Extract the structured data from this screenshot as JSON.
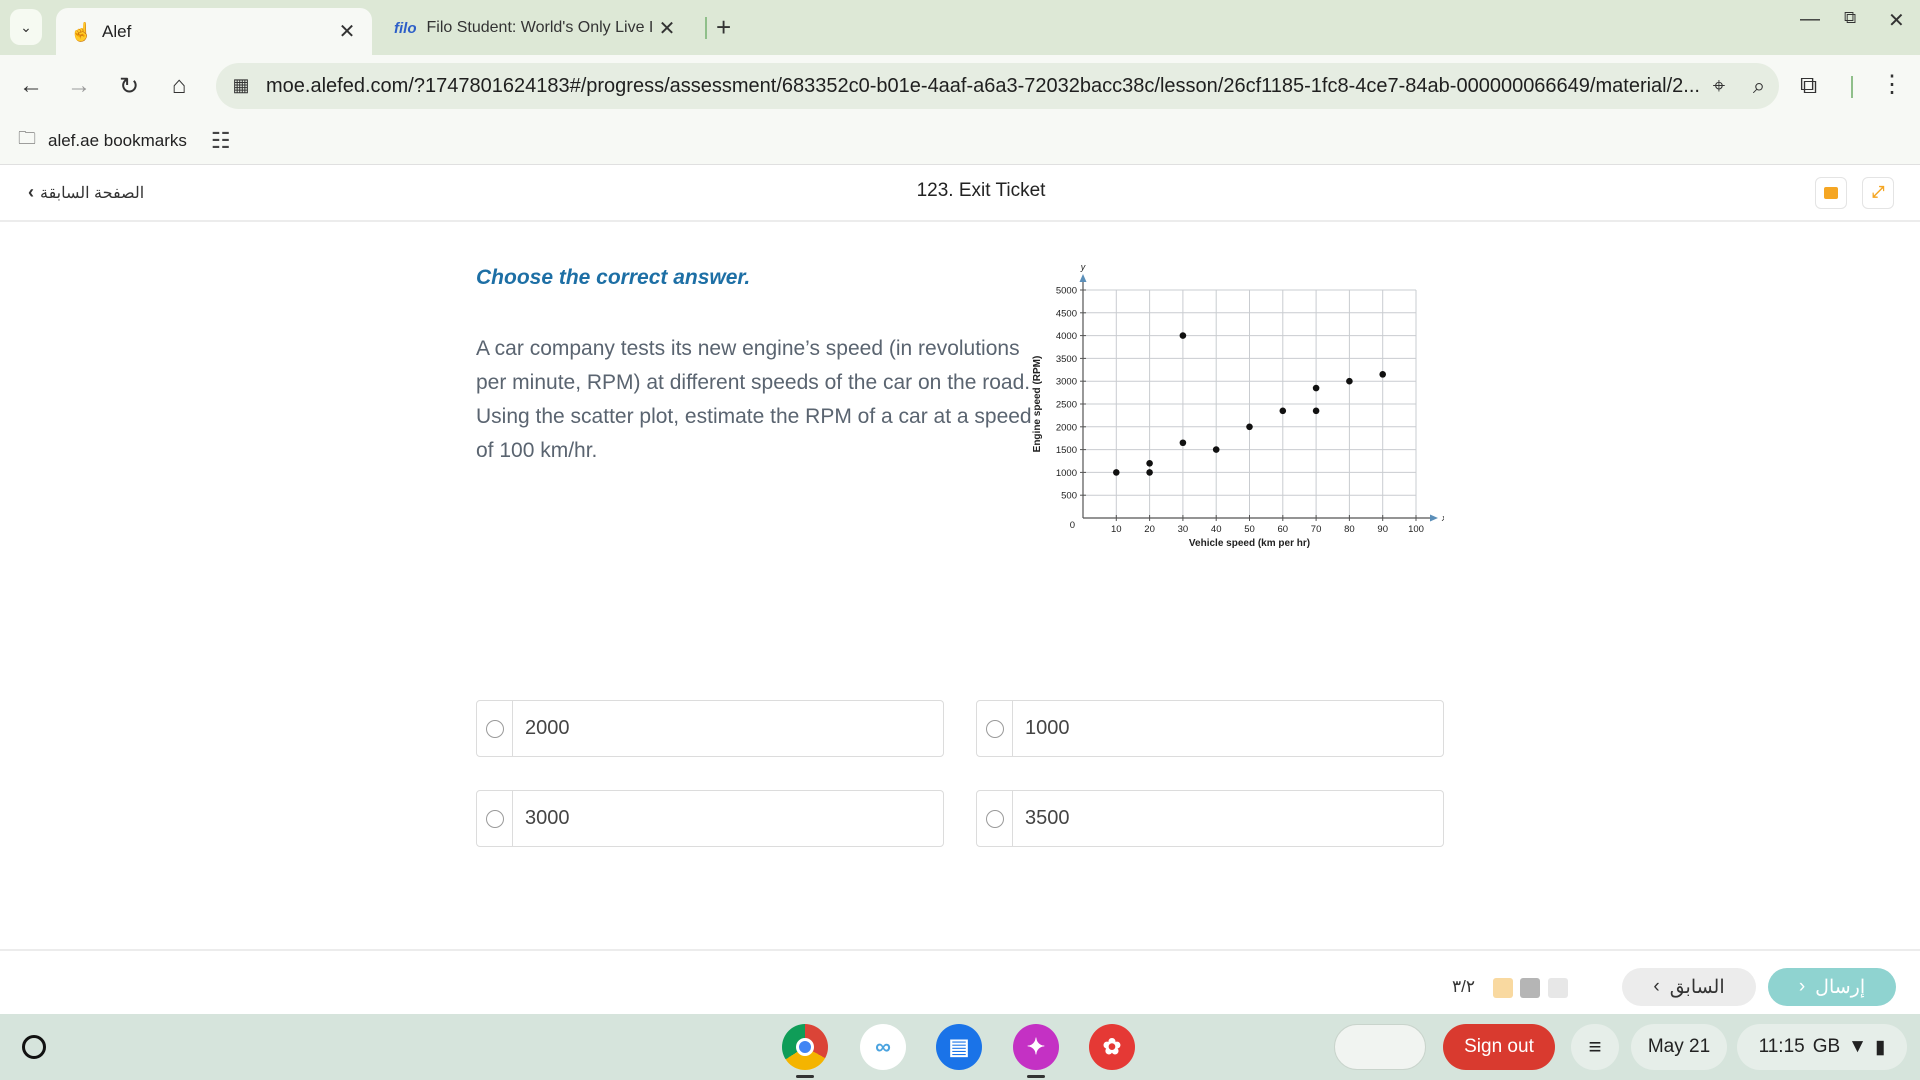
{
  "browser": {
    "tabs": [
      {
        "title": "Alef",
        "active": true,
        "icon": "alef-hand-icon"
      },
      {
        "title": "Filo Student: World's Only Live I",
        "active": false,
        "icon": "filo-logo",
        "logo_text": "filo"
      }
    ],
    "url": "moe.alefed.com/?1747801624183#/progress/assessment/683352c0-b01e-4aaf-a6a3-72032bacc38c/lesson/26cf1185-1fc8-4ce7-84ab-000000066649/material/2...",
    "bookmarks": [
      {
        "label": "alef.ae bookmarks"
      }
    ]
  },
  "page": {
    "back_label": "الصفحة السابقة",
    "title": "123. Exit Ticket",
    "instruction": "Choose the correct answer.",
    "question_lines": [
      "A car company tests its new engine’s speed (in revolutions per minute, RPM) at different speeds of the car on the road.",
      "Using the scatter plot, estimate the RPM of a car at a speed of 100 km/hr."
    ],
    "options": [
      {
        "label": "2000"
      },
      {
        "label": "1000"
      },
      {
        "label": "3000"
      },
      {
        "label": "3500"
      }
    ]
  },
  "chart_data": {
    "type": "scatter",
    "xlabel": "Vehicle speed (km per hr)",
    "ylabel": "Engine speed (RPM)",
    "x_axis_letter": "x",
    "y_axis_letter": "y",
    "xlim": [
      0,
      100
    ],
    "ylim": [
      0,
      5000
    ],
    "x_ticks": [
      10,
      20,
      30,
      40,
      50,
      60,
      70,
      80,
      90,
      100
    ],
    "y_ticks": [
      500,
      1000,
      1500,
      2000,
      2500,
      3000,
      3500,
      4000,
      4500,
      5000
    ],
    "origin_label": "0",
    "grid": true,
    "points": [
      {
        "x": 10,
        "y": 1000
      },
      {
        "x": 20,
        "y": 1000
      },
      {
        "x": 20,
        "y": 1200
      },
      {
        "x": 30,
        "y": 4000
      },
      {
        "x": 30,
        "y": 1650
      },
      {
        "x": 40,
        "y": 1500
      },
      {
        "x": 50,
        "y": 2000
      },
      {
        "x": 60,
        "y": 2350
      },
      {
        "x": 70,
        "y": 2350
      },
      {
        "x": 70,
        "y": 2850
      },
      {
        "x": 80,
        "y": 3000
      },
      {
        "x": 90,
        "y": 3150
      }
    ]
  },
  "footer": {
    "submit_label": "إرسال",
    "previous_label": "السابق",
    "progress_text": "٣/٢",
    "progress_colors": [
      "#f9d9a0",
      "#b5b5b5",
      "#e7e7e7"
    ]
  },
  "shelf": {
    "signout_label": "Sign out",
    "date": "May 21",
    "time": "11:15",
    "locale": "GB",
    "apps": [
      "chrome-icon",
      "link-app-icon",
      "files-icon",
      "canvas-app-icon",
      "palette-app-icon"
    ]
  }
}
